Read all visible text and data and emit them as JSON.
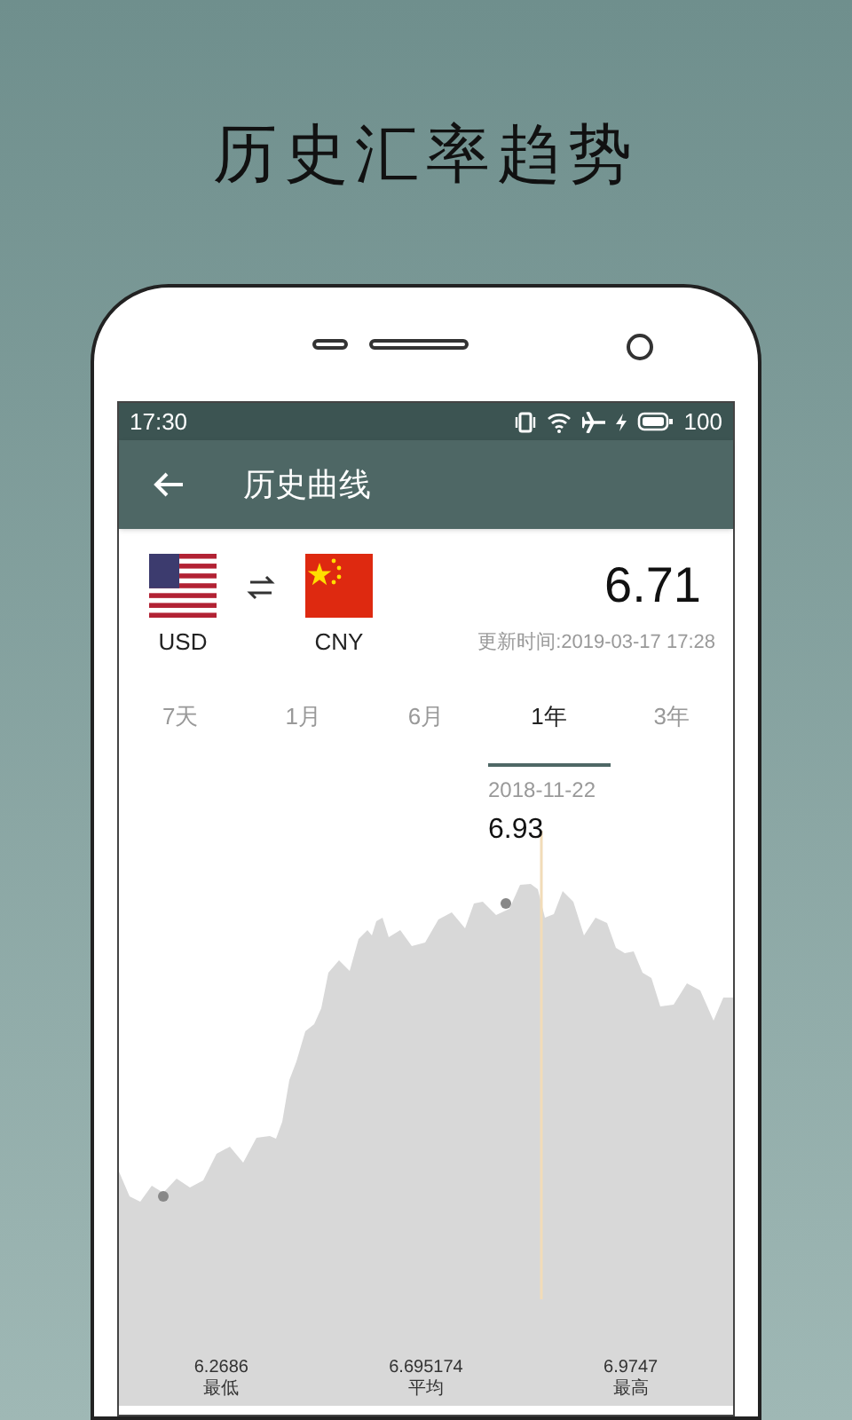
{
  "promo_title": "历史汇率趋势",
  "status_bar": {
    "time": "17:30",
    "battery": "100"
  },
  "app_bar": {
    "title": "历史曲线"
  },
  "pair": {
    "base": "USD",
    "quote": "CNY",
    "rate": "6.71",
    "updated": "更新时间:2019-03-17 17:28"
  },
  "tabs": [
    {
      "label": "7天",
      "selected": false
    },
    {
      "label": "1月",
      "selected": false
    },
    {
      "label": "6月",
      "selected": false
    },
    {
      "label": "1年",
      "selected": true
    },
    {
      "label": "3年",
      "selected": false
    }
  ],
  "chart": {
    "tooltip_date": "2018-11-22",
    "tooltip_value": "6.93",
    "stats": [
      {
        "value": "6.2686",
        "label": "最低"
      },
      {
        "value": "6.695174",
        "label": "平均"
      },
      {
        "value": "6.9747",
        "label": "最高"
      }
    ]
  }
}
